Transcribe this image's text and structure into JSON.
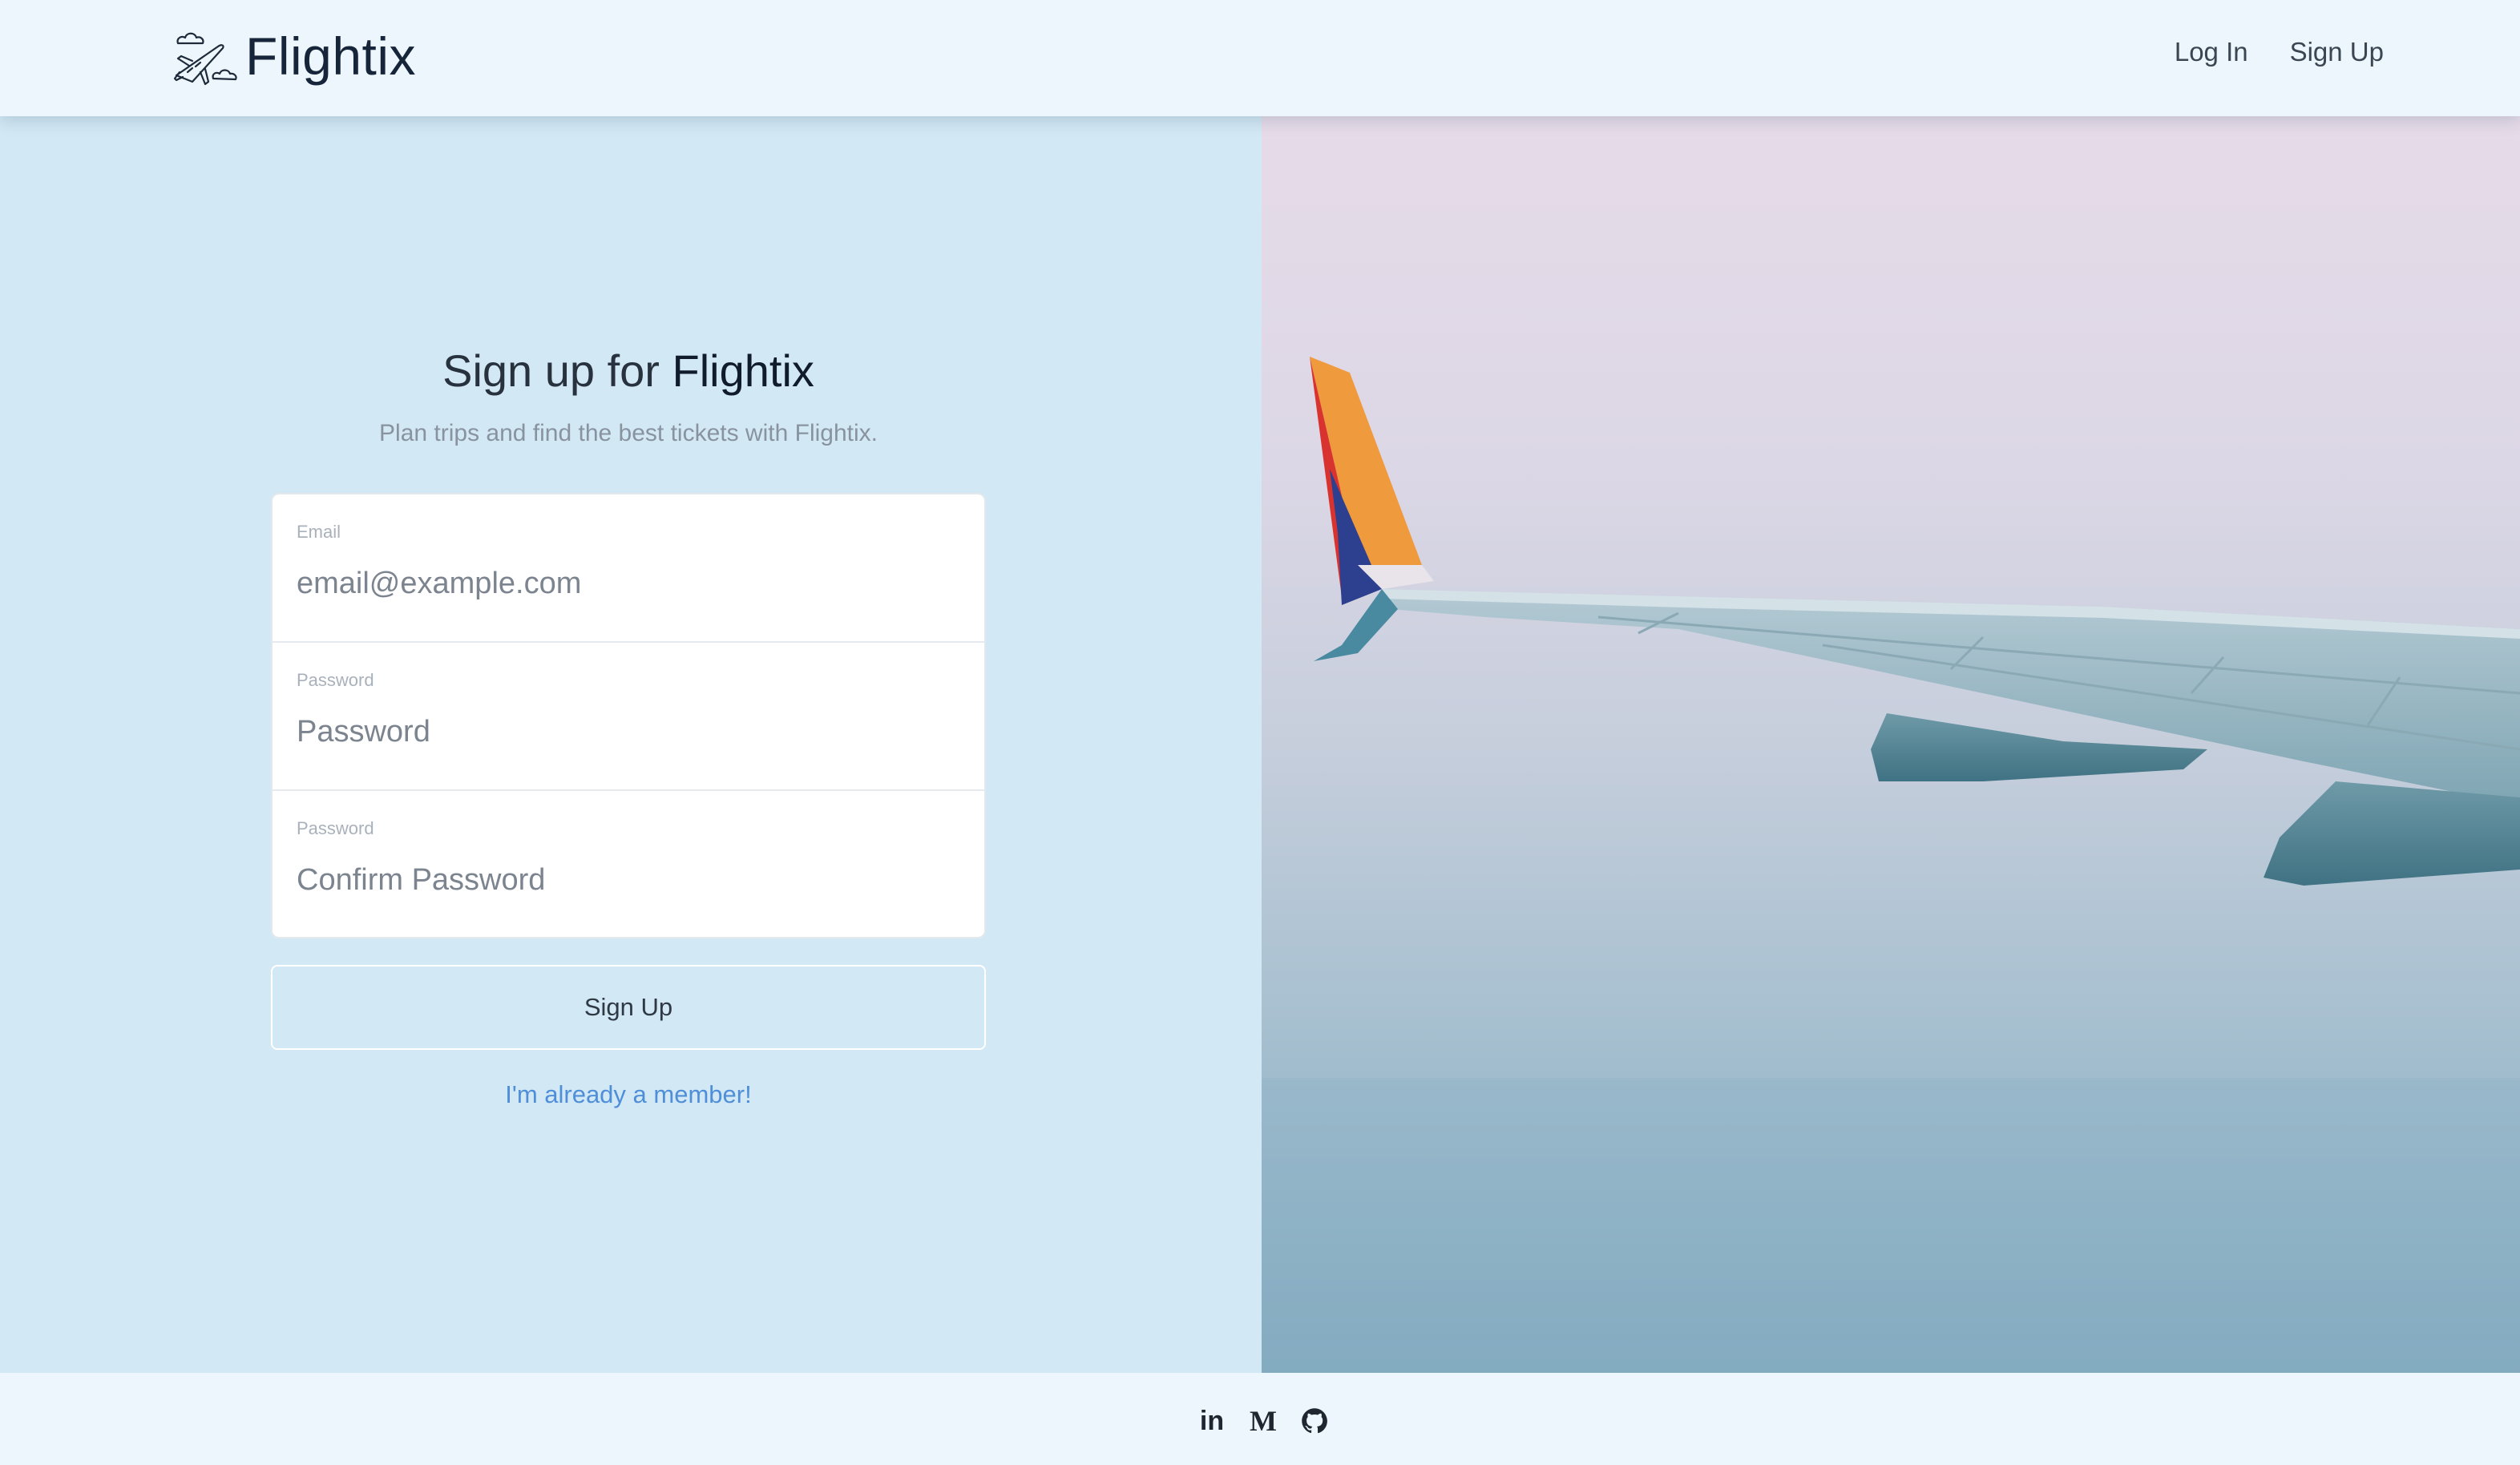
{
  "header": {
    "brand_name": "Flightix",
    "nav": {
      "login_label": "Log In",
      "signup_label": "Sign Up"
    }
  },
  "signup_form": {
    "title_prefix": "Sign up for ",
    "title_brand": "Flightix",
    "subtitle": "Plan trips and find the best tickets with Flightix.",
    "fields": {
      "email": {
        "label": "Email",
        "placeholder": "email@example.com",
        "value": ""
      },
      "password": {
        "label": "Password",
        "placeholder": "Password",
        "value": ""
      },
      "confirm_password": {
        "label": "Password",
        "placeholder": "Confirm Password",
        "value": ""
      }
    },
    "submit_label": "Sign Up",
    "member_link": "I'm already a member!"
  },
  "footer": {
    "social_icons": [
      "linkedin-icon",
      "medium-icon",
      "github-icon"
    ],
    "linkedin_glyph": "in",
    "medium_glyph": "M"
  },
  "colors": {
    "header_bg": "#eef6fd",
    "panel_bg": "#d2e8f4",
    "link": "#4f8fd9",
    "brand_text": "#16253a"
  }
}
